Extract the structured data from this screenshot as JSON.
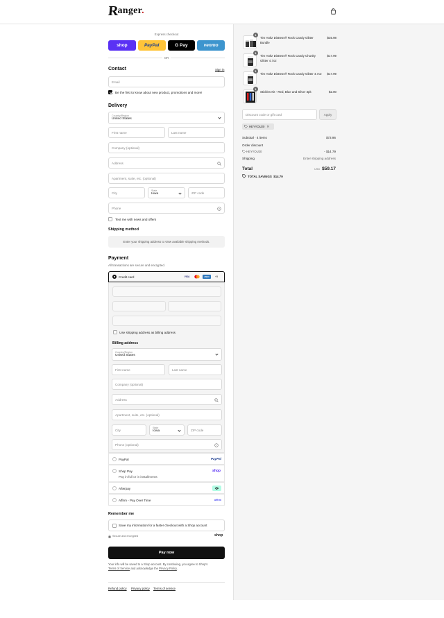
{
  "brand": {
    "logo_first": "R",
    "logo_rest": "anger",
    "logo_dot": "."
  },
  "express": {
    "label": "Express checkout",
    "or": "OR",
    "buttons": {
      "shop": "shop",
      "paypal": "PayPal",
      "gpay": "G Pay",
      "venmo": "venmo"
    }
  },
  "contact": {
    "title": "Contact",
    "signin": "Sign in",
    "email_placeholder": "Email",
    "newsletter": "Be the first to know about new product, promotions and more!"
  },
  "delivery": {
    "title": "Delivery",
    "country_label": "Country/Region",
    "country": "United States",
    "first_name": "First name",
    "last_name": "Last name",
    "company": "Company (optional)",
    "address": "Address",
    "apartment": "Apartment, suite, etc. (optional)",
    "city": "City",
    "state_label": "State",
    "state": "Iowa",
    "zip": "ZIP code",
    "phone": "Phone",
    "text_me": "Text me with news and offers"
  },
  "shipping_method": {
    "title": "Shipping method",
    "note": "Enter your shipping address to view available shipping methods."
  },
  "payment": {
    "title": "Payment",
    "subtitle": "All transactions are secure and encrypted.",
    "credit_card": "Credit card",
    "cards": {
      "visa": "VISA",
      "amex": "AMEX",
      "more": "+5"
    },
    "use_shipping": "Use shipping address as billing address",
    "billing_title": "Billing address",
    "billing": {
      "country_label": "Country/Region",
      "country": "United States",
      "first_name": "First name",
      "last_name": "Last name",
      "company": "Company (optional)",
      "address": "Address",
      "apartment": "Apartment, suite, etc. (optional)",
      "city": "City",
      "state_label": "State",
      "state": "Iowa",
      "zip": "ZIP code",
      "phone": "Phone (optional)"
    },
    "paypal": "PayPal",
    "paypal_logo": "PayPal",
    "shop_pay": "Shop Pay",
    "shop_pay_sub": "Pay in full or in installments",
    "shop_logo": "shop",
    "afterpay": "Afterpay",
    "affirm": "Affirm - Pay Over Time",
    "affirm_logo": "affirm"
  },
  "remember": {
    "title": "Remember me",
    "save_info": "Save my information for a faster checkout with a Shop account",
    "secure": "Secure and encrypted",
    "shop_logo": "shop"
  },
  "pay_now": "Pay now",
  "legal": {
    "line1": "Your info will be saved to a Shop account. By continuing, you agree to Shop's",
    "terms": "Terms of Service",
    "and": " and acknowledge the ",
    "privacy": "Privacy Policy",
    "dot": "."
  },
  "footer": {
    "refund": "Refund policy",
    "privacy": "Privacy policy",
    "terms": "Terms of service"
  },
  "cart": {
    "items": [
      {
        "name": "Tim Holtz Distress® Rock Candy Glitter Bundle",
        "price": "$35.98",
        "qty": "1"
      },
      {
        "name": "Tim Holtz Distress® Rock Candy Chunky Glitter 4.7oz",
        "price": "$17.99",
        "qty": "1"
      },
      {
        "name": "Tim Holtz Distress® Rock Candy Glitter 4.7oz",
        "price": "$17.99",
        "qty": "1"
      },
      {
        "name": "Stickles Kit - Red, Blue and Silver 3pk",
        "price": "$2.00",
        "qty": "1"
      }
    ],
    "discount_placeholder": "Discount code or gift card",
    "apply": "Apply",
    "code_tag": "HEYYOU20",
    "subtotal_label": "Subtotal · 4 items",
    "subtotal": "$73.96",
    "order_discount_label": "Order discount",
    "discount_code": "HEYYOU20",
    "discount_value": "- $14.79",
    "shipping_label": "Shipping",
    "shipping_value": "Enter shipping address",
    "total_label": "Total",
    "currency": "USD",
    "total": "$59.17",
    "savings_label": "TOTAL SAVINGS",
    "savings": "$14.79"
  },
  "colors": {
    "shop": "#5a31f4",
    "paypal": "#ffc439",
    "venmo": "#3d95ce",
    "black": "#111111"
  }
}
